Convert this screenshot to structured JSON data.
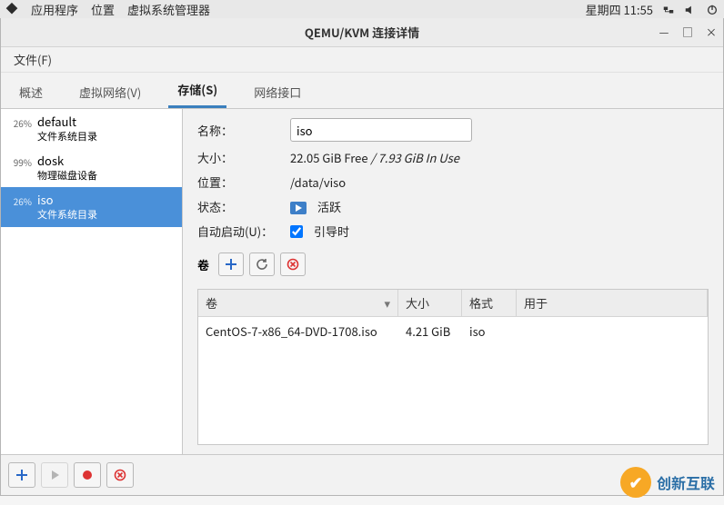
{
  "desktop": {
    "apps_label": "应用程序",
    "places_label": "位置",
    "vmm_label": "虚拟系统管理器",
    "clock": "星期四 11:55"
  },
  "window": {
    "title": "QEMU/KVM 连接详情",
    "min": "—",
    "max": "□",
    "close": "×"
  },
  "menubar": {
    "file": "文件(F)"
  },
  "tabs": [
    {
      "label": "概述"
    },
    {
      "label": "虚拟网络(V)"
    },
    {
      "label": "存储(S)",
      "active": true
    },
    {
      "label": "网络接口"
    }
  ],
  "pools": [
    {
      "pct": "26%",
      "name": "default",
      "sub": "文件系统目录"
    },
    {
      "pct": "99%",
      "name": "dosk",
      "sub": "物理磁盘设备"
    },
    {
      "pct": "26%",
      "name": "iso",
      "sub": "文件系统目录",
      "selected": true
    }
  ],
  "detail": {
    "name_label": "名称：",
    "name_value": "iso",
    "size_label": "大小：",
    "size_value_free": "22.05 GiB Free",
    "size_sep": " / ",
    "size_value_used": "7.93 GiB In Use",
    "location_label": "位置：",
    "location_value": "/data/viso",
    "state_label": "状态：",
    "state_value": "活跃",
    "autostart_label": "自动启动(U)：",
    "autostart_value": "引导时",
    "volumes_label": "卷"
  },
  "volumes_table": {
    "headers": {
      "name": "卷",
      "size": "大小",
      "fmt": "格式",
      "use": "用于"
    },
    "rows": [
      {
        "name": "CentOS-7-x86_64-DVD-1708.iso",
        "size": "4.21 GiB",
        "fmt": "iso",
        "use": ""
      }
    ]
  },
  "watermark": {
    "text": "创新互联"
  }
}
